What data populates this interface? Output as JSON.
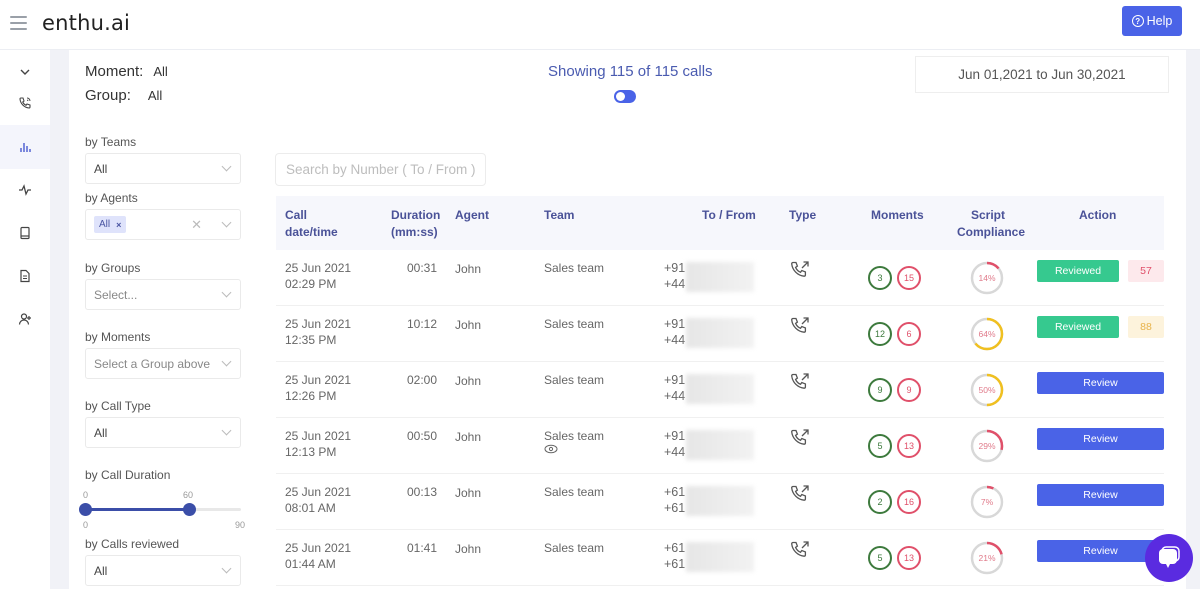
{
  "app": {
    "logo": "enthu.ai",
    "help_label": "Help"
  },
  "sidenav": [
    {
      "name": "collapse",
      "icon": "chevron-down-icon"
    },
    {
      "name": "calls",
      "icon": "phone-icon"
    },
    {
      "name": "analytics",
      "icon": "bar-chart-icon",
      "active": true
    },
    {
      "name": "activity",
      "icon": "activity-icon"
    },
    {
      "name": "library",
      "icon": "book-icon"
    },
    {
      "name": "documents",
      "icon": "document-icon"
    },
    {
      "name": "add-user",
      "icon": "add-user-icon"
    }
  ],
  "summary": {
    "moment_label": "Moment:",
    "moment_value": "All",
    "group_label": "Group:",
    "group_value": "All",
    "showing": "Showing 115 of 115 calls",
    "toggle_on": true,
    "date_range": "Jun 01,2021 to Jun 30,2021"
  },
  "filters": {
    "teams": {
      "label": "by Teams",
      "value": "All"
    },
    "agents": {
      "label": "by Agents",
      "chip": "All",
      "chip_remove": "×",
      "clear": "✕"
    },
    "groups": {
      "label": "by Groups",
      "placeholder": "Select..."
    },
    "moments": {
      "label": "by Moments",
      "placeholder": "Select a Group above"
    },
    "call_type": {
      "label": "by Call Type",
      "value": "All"
    },
    "call_duration": {
      "label": "by Call Duration",
      "min": "0",
      "max": "90",
      "low": "0",
      "high": "60",
      "low_value": 0,
      "high_value": 60,
      "range_max": 90
    },
    "calls_reviewed": {
      "label": "by Calls reviewed",
      "value": "All"
    }
  },
  "search": {
    "placeholder": "Search by Number ( To / From )"
  },
  "table": {
    "headers": {
      "datetime_1": "Call",
      "datetime_2": "date/time",
      "duration_1": "Duration",
      "duration_2": "(mm:ss)",
      "agent": "Agent",
      "team": "Team",
      "tofrom": "To / From",
      "type": "Type",
      "moments": "Moments",
      "compliance_1": "Script",
      "compliance_2": "Compliance",
      "action": "Action"
    },
    "rows": [
      {
        "date": "25 Jun 2021",
        "time": "02:29 PM",
        "duration": "00:31",
        "agent": "John",
        "team": "Sales team",
        "to": "+91",
        "from": "+44",
        "m_pos": "3",
        "m_neg": "15",
        "compliance": 14,
        "compliance_label": "14%",
        "action": "Reviewed",
        "score": "57",
        "score_color": "#e0506a",
        "score_bg": "#fde9ec"
      },
      {
        "date": "25 Jun 2021",
        "time": "12:35 PM",
        "duration": "10:12",
        "agent": "John",
        "team": "Sales team",
        "to": "+91",
        "from": "+44",
        "m_pos": "12",
        "m_neg": "6",
        "compliance": 64,
        "compliance_label": "64%",
        "action": "Reviewed",
        "score": "88",
        "score_color": "#e8b34a",
        "score_bg": "#fdf3dc"
      },
      {
        "date": "25 Jun 2021",
        "time": "12:26 PM",
        "duration": "02:00",
        "agent": "John",
        "team": "Sales team",
        "to": "+91",
        "from": "+44",
        "m_pos": "9",
        "m_neg": "9",
        "compliance": 50,
        "compliance_label": "50%",
        "action": "Review"
      },
      {
        "date": "25 Jun 2021",
        "time": "12:13 PM",
        "duration": "00:50",
        "agent": "John",
        "team": "Sales team",
        "to": "+91",
        "from": "+44",
        "m_pos": "5",
        "m_neg": "13",
        "compliance": 29,
        "compliance_label": "29%",
        "action": "Review",
        "viewed": true
      },
      {
        "date": "25 Jun 2021",
        "time": "08:01 AM",
        "duration": "00:13",
        "agent": "John",
        "team": "Sales team",
        "to": "+61",
        "from": "+61",
        "m_pos": "2",
        "m_neg": "16",
        "compliance": 7,
        "compliance_label": "7%",
        "action": "Review"
      },
      {
        "date": "25 Jun 2021",
        "time": "01:44 AM",
        "duration": "01:41",
        "agent": "John",
        "team": "Sales team",
        "to": "+61",
        "from": "+61",
        "m_pos": "5",
        "m_neg": "13",
        "compliance": 21,
        "compliance_label": "21%",
        "action": "Review"
      }
    ]
  },
  "colors": {
    "accent": "#4a63e7",
    "reviewed": "#36c98f",
    "positive": "#3d7a3d",
    "negative": "#e0506a",
    "warn": "#f0c020",
    "track": "#d8d8d8"
  }
}
